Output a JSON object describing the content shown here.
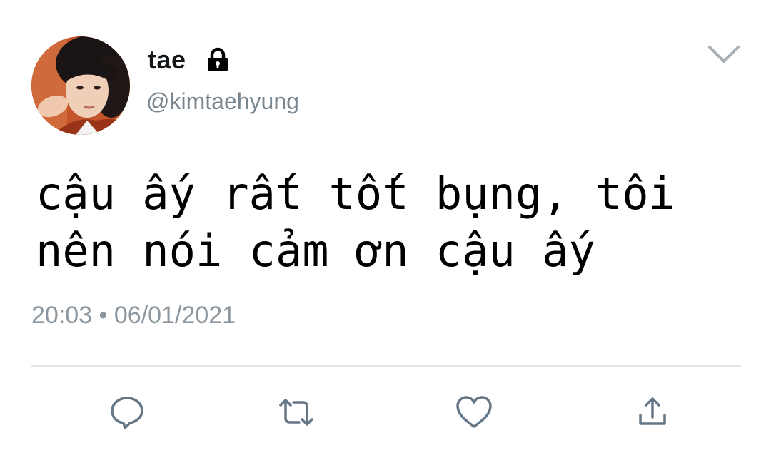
{
  "tweet": {
    "display_name": "tae",
    "handle": "@kimtaehyung",
    "text_lines": [
      "cậu ấy rất tốt bụng, tôi",
      "nên nói cảm ơn cậu ấy"
    ],
    "timestamp": "20:03 • 06/01/2021"
  },
  "icons": {
    "lock": "lock-icon",
    "menu": "chevron-down-icon",
    "reply": "reply-icon",
    "retweet": "retweet-icon",
    "like": "heart-icon",
    "share": "share-icon"
  },
  "colors": {
    "name": "#14171a",
    "secondary_text": "#7a868f",
    "icon": "#657786",
    "divider": "#e3e7ea"
  }
}
